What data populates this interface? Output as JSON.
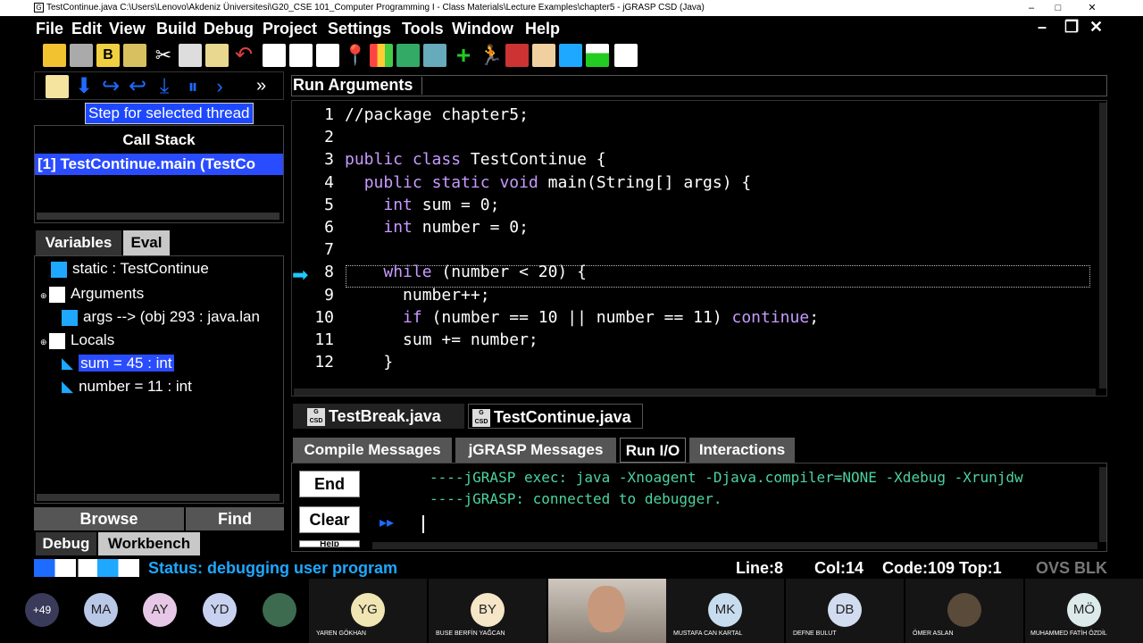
{
  "window": {
    "title": "TestContinue.java  C:\\Users\\Lenovo\\Akdeniz Üniversitesi\\G20_CSE 101_Computer Programming I - Class Materials\\Lecture Examples\\chapter5 - jGRASP CSD (Java)",
    "minimize": "–",
    "maximize": "□",
    "close": "✕"
  },
  "menu": [
    "File",
    "Edit",
    "View",
    "Build",
    "Debug",
    "Project",
    "Settings",
    "Tools",
    "Window",
    "Help"
  ],
  "menu_right": {
    "min": "–",
    "restore": "❐",
    "close": "✕"
  },
  "debug_toolbar": {
    "overflow": "»",
    "tooltip": "Step for selected thread"
  },
  "call_stack": {
    "title": "Call Stack",
    "item": "[1] TestContinue.main (TestCo"
  },
  "var_tabs": [
    "Variables",
    "Eval"
  ],
  "variables": [
    {
      "label": "static  :  TestContinue"
    },
    {
      "label": "Arguments"
    },
    {
      "label": "args --> (obj 293 : java.lan"
    },
    {
      "label": "Locals"
    },
    {
      "label": "sum = 45  :  int"
    },
    {
      "label": "number = 11  :  int"
    }
  ],
  "left_bottom": {
    "browse": "Browse",
    "find": "Find",
    "tab1": "Debug",
    "tab2": "Workbench"
  },
  "run_args": {
    "label": "Run Arguments"
  },
  "code_lines": [
    {
      "n": "1",
      "text": "//package chapter5;"
    },
    {
      "n": "2",
      "text": ""
    },
    {
      "n": "3",
      "text": "public class TestContinue {"
    },
    {
      "n": "4",
      "text": "  public static void main(String[] args) {"
    },
    {
      "n": "5",
      "text": "    int sum = 0;"
    },
    {
      "n": "6",
      "text": "    int number = 0;"
    },
    {
      "n": "7",
      "text": ""
    },
    {
      "n": "8",
      "text": "    while (number < 20) {"
    },
    {
      "n": "9",
      "text": "      number++;"
    },
    {
      "n": "10",
      "text": "      if (number == 10 || number == 11) continue;"
    },
    {
      "n": "11",
      "text": "      sum += number;"
    },
    {
      "n": "12",
      "text": "    }"
    }
  ],
  "file_tabs": [
    "TestBreak.java",
    "TestContinue.java"
  ],
  "csd_icon": "G CSD",
  "msg_tabs": [
    "Compile Messages",
    "jGRASP Messages",
    "Run I/O",
    "Interactions"
  ],
  "io_buttons": {
    "end": "End",
    "clear": "Clear",
    "help": "Help"
  },
  "console": [
    "----jGRASP exec: java -Xnoagent -Djava.compiler=NONE -Xdebug -Xrunjdw",
    "----jGRASP: connected to debugger."
  ],
  "status": {
    "text": "Status: debugging user program",
    "line": "Line:8",
    "col": "Col:14",
    "code": "Code:109",
    "top": "Top:1",
    "mode": "OVS BLK"
  },
  "participants": [
    {
      "initials": "+49",
      "color": "#3a3a5a",
      "name": ""
    },
    {
      "initials": "MA",
      "color": "#b9c8e6",
      "name": ""
    },
    {
      "initials": "AY",
      "color": "#e6c8e6",
      "name": ""
    },
    {
      "initials": "YD",
      "color": "#c8d2f0",
      "name": ""
    },
    {
      "initials": "",
      "color": "#3d6b4f",
      "name": ""
    },
    {
      "initials": "YG",
      "color": "#f0e6b4",
      "name": "YAREN GÖKHAN"
    },
    {
      "initials": "BY",
      "color": "#f5e6c8",
      "name": "BUSE BERFİN YAĞCAN"
    },
    {
      "initials": "",
      "color": "#8c7a6a",
      "name": ""
    },
    {
      "initials": "MK",
      "color": "#c8dcf0",
      "name": "MUSTAFA CAN KARTAL"
    },
    {
      "initials": "DB",
      "color": "#d2dcf0",
      "name": "DEFNE BULUT"
    },
    {
      "initials": "",
      "color": "#5a4a3a",
      "name": "ÖMER ASLAN"
    },
    {
      "initials": "MÖ",
      "color": "#dceaea",
      "name": "MUHAMMED FATİH ÖZDİL"
    }
  ],
  "colors": {
    "accent": "#1e6bff",
    "selection": "#2a4cff",
    "string": "#4cd3a0",
    "keyword": "#c79bff",
    "execArrow": "#1ec8ff"
  }
}
